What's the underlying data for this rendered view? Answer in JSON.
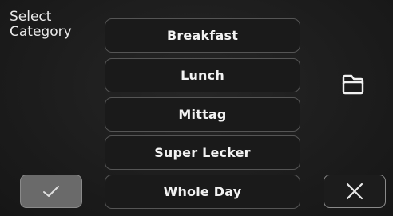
{
  "header": {
    "title_line1": "Select",
    "title_line2": "Category"
  },
  "categories": [
    {
      "label": "Breakfast"
    },
    {
      "label": "Lunch"
    },
    {
      "label": "Mittag"
    },
    {
      "label": "Super Lecker"
    },
    {
      "label": "Whole Day"
    }
  ],
  "actions": {
    "confirm_icon": "checkmark-icon",
    "cancel_icon": "close-icon",
    "folder_icon": "folder-icon"
  },
  "colors": {
    "background": "#1b1b1b",
    "button_border": "#555555",
    "confirm_fill": "#6a6a6a",
    "text": "#f2f2f2"
  }
}
